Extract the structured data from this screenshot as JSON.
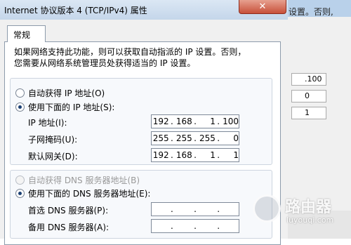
{
  "window": {
    "title": "Internet 协议版本 4 (TCP/IPv4) 属性",
    "close_label": "✕"
  },
  "background_window": {
    "text": "设置。否则,",
    "fields": [
      ".100",
      "0",
      "1"
    ]
  },
  "tabs": [
    {
      "label": "常规"
    }
  ],
  "intro": {
    "line1": "如果网络支持此功能，则可以获取自动指派的 IP 设置。否则，",
    "line2": "您需要从网络系统管理员处获得适当的 IP 设置。"
  },
  "ip_section": {
    "auto_label": "自动获得 IP 地址(O)",
    "manual_label": "使用下面的 IP 地址(S):",
    "selected": "manual",
    "fields": [
      {
        "label": "IP 地址(I):",
        "octets": [
          "192",
          "168",
          "1",
          "100"
        ]
      },
      {
        "label": "子网掩码(U):",
        "octets": [
          "255",
          "255",
          "255",
          "0"
        ]
      },
      {
        "label": "默认网关(D):",
        "octets": [
          "192",
          "168",
          "1",
          "1"
        ]
      }
    ]
  },
  "dns_section": {
    "auto_label": "自动获得 DNS 服务器地址(B)",
    "manual_label": "使用下面的 DNS 服务器地址(E):",
    "selected": "manual",
    "fields": [
      {
        "label": "首选 DNS 服务器(P):",
        "octets": [
          "",
          "",
          "",
          ""
        ]
      },
      {
        "label": "备用 DNS 服务器(A):",
        "octets": [
          "",
          "",
          "",
          ""
        ]
      }
    ]
  },
  "watermark": {
    "text": "路由器",
    "url": "luyouqi.com"
  }
}
